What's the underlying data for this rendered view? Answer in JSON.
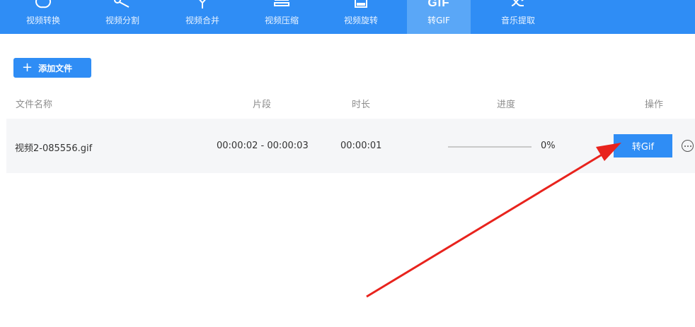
{
  "toolbar": {
    "items": [
      {
        "label": "视频转换",
        "icon": "convert-icon"
      },
      {
        "label": "视频分割",
        "icon": "scissors-icon"
      },
      {
        "label": "视频合并",
        "icon": "merge-icon"
      },
      {
        "label": "视频压缩",
        "icon": "compress-icon"
      },
      {
        "label": "视频旋转",
        "icon": "rotate-icon"
      },
      {
        "label": "转GIF",
        "icon": "gif-icon",
        "icon_text": "GIF",
        "active": true
      },
      {
        "label": "音乐提取",
        "icon": "music-extract-icon"
      }
    ]
  },
  "add_file": {
    "label": "添加文件"
  },
  "table": {
    "columns": [
      "文件名称",
      "片段",
      "时长",
      "进度",
      "操作"
    ],
    "rows": [
      {
        "filename": "视频2-085556.gif",
        "segment": "00:00:02 - 00:00:03",
        "duration": "00:00:01",
        "progress_text": "0%",
        "progress_fraction": 0,
        "action_label": "转Gif"
      }
    ]
  },
  "colors": {
    "accent": "#2f8df5",
    "annotation_arrow": "#e8231d"
  }
}
